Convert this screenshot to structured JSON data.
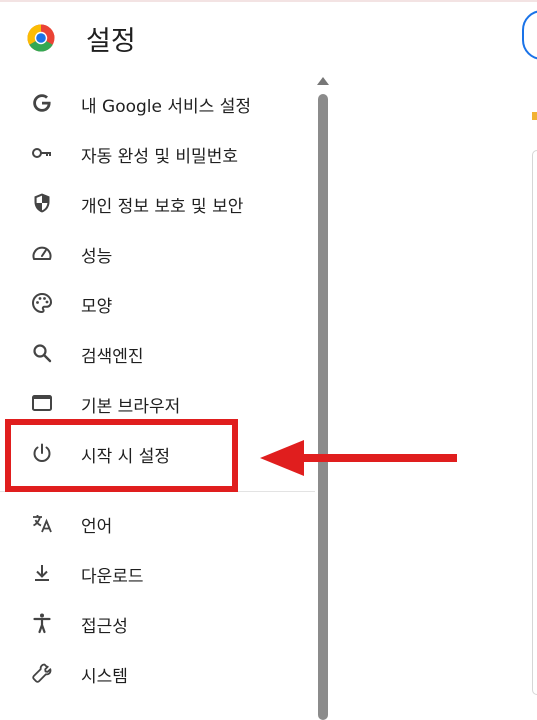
{
  "header": {
    "title": "설정"
  },
  "nav": {
    "items": [
      {
        "label": "내 Google 서비스 설정",
        "icon": "google-g-icon"
      },
      {
        "label": "자동 완성 및 비밀번호",
        "icon": "key-icon"
      },
      {
        "label": "개인 정보 보호 및 보안",
        "icon": "shield-icon"
      },
      {
        "label": "성능",
        "icon": "speedometer-icon"
      },
      {
        "label": "모양",
        "icon": "palette-icon"
      },
      {
        "label": "검색엔진",
        "icon": "search-icon"
      },
      {
        "label": "기본 브라우저",
        "icon": "browser-window-icon"
      },
      {
        "label": "시작 시 설정",
        "icon": "power-icon"
      },
      {
        "label": "언어",
        "icon": "translate-icon"
      },
      {
        "label": "다운로드",
        "icon": "download-icon"
      },
      {
        "label": "접근성",
        "icon": "accessibility-icon"
      },
      {
        "label": "시스템",
        "icon": "wrench-icon"
      }
    ]
  },
  "annotation": {
    "highlighted_item": "시작 시 설정",
    "color": "#e01e1e"
  }
}
